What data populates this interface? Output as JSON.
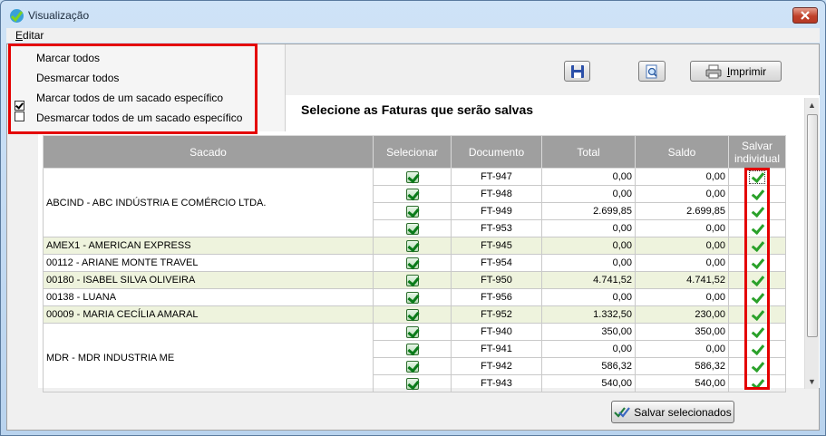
{
  "window": {
    "title": "Visualização"
  },
  "menubar": {
    "editar_prefix": "E",
    "editar_rest": "ditar"
  },
  "dropdown": {
    "items": [
      "Marcar todos",
      "Desmarcar todos",
      "Marcar todos de um sacado específico",
      "Desmarcar todos de um sacado específico"
    ]
  },
  "toolbar": {
    "print_label": "Imprimir",
    "print_underline": "I",
    "print_rest": "mprimir"
  },
  "heading": "Selecione as Faturas que serão salvas",
  "table": {
    "headers": {
      "sacado": "Sacado",
      "selecionar": "Selecionar",
      "documento": "Documento",
      "total": "Total",
      "saldo": "Saldo",
      "salvar": "Salvar individual"
    },
    "groups": [
      {
        "sacado": "ABCIND - ABC INDÚSTRIA E COMÉRCIO LTDA.",
        "alt": false,
        "rows": [
          {
            "documento": "FT-947",
            "total": "0,00",
            "saldo": "0,00"
          },
          {
            "documento": "FT-948",
            "total": "0,00",
            "saldo": "0,00"
          },
          {
            "documento": "FT-949",
            "total": "2.699,85",
            "saldo": "2.699,85"
          },
          {
            "documento": "FT-953",
            "total": "0,00",
            "saldo": "0,00"
          }
        ]
      },
      {
        "sacado": "AMEX1 - AMERICAN EXPRESS",
        "alt": true,
        "rows": [
          {
            "documento": "FT-945",
            "total": "0,00",
            "saldo": "0,00"
          }
        ]
      },
      {
        "sacado": "00112 - ARIANE MONTE TRAVEL",
        "alt": false,
        "rows": [
          {
            "documento": "FT-954",
            "total": "0,00",
            "saldo": "0,00"
          }
        ]
      },
      {
        "sacado": "00180 - ISABEL SILVA OLIVEIRA",
        "alt": true,
        "rows": [
          {
            "documento": "FT-950",
            "total": "4.741,52",
            "saldo": "4.741,52"
          }
        ]
      },
      {
        "sacado": "00138 - LUANA",
        "alt": false,
        "rows": [
          {
            "documento": "FT-956",
            "total": "0,00",
            "saldo": "0,00"
          }
        ]
      },
      {
        "sacado": "00009 - MARIA CECÍLIA AMARAL",
        "alt": true,
        "rows": [
          {
            "documento": "FT-952",
            "total": "1.332,50",
            "saldo": "230,00"
          }
        ]
      },
      {
        "sacado": "MDR - MDR INDUSTRIA ME",
        "alt": false,
        "rows": [
          {
            "documento": "FT-940",
            "total": "350,00",
            "saldo": "350,00"
          },
          {
            "documento": "FT-941",
            "total": "0,00",
            "saldo": "0,00"
          },
          {
            "documento": "FT-942",
            "total": "586,32",
            "saldo": "586,32"
          },
          {
            "documento": "FT-943",
            "total": "540,00",
            "saldo": "540,00"
          }
        ]
      }
    ]
  },
  "footer": {
    "save_selected_label": "Salvar selecionados"
  },
  "colors": {
    "highlight": "#e40000",
    "header_bg": "#9f9f9f",
    "alt_row": "#eef3dd",
    "check_green": "#0b7b1a"
  },
  "icons": [
    "app-logo-icon",
    "close-icon",
    "floppy-disk-icon",
    "magnifier-page-icon",
    "printer-icon",
    "checkbox-checked-icon",
    "green-check-icon"
  ]
}
